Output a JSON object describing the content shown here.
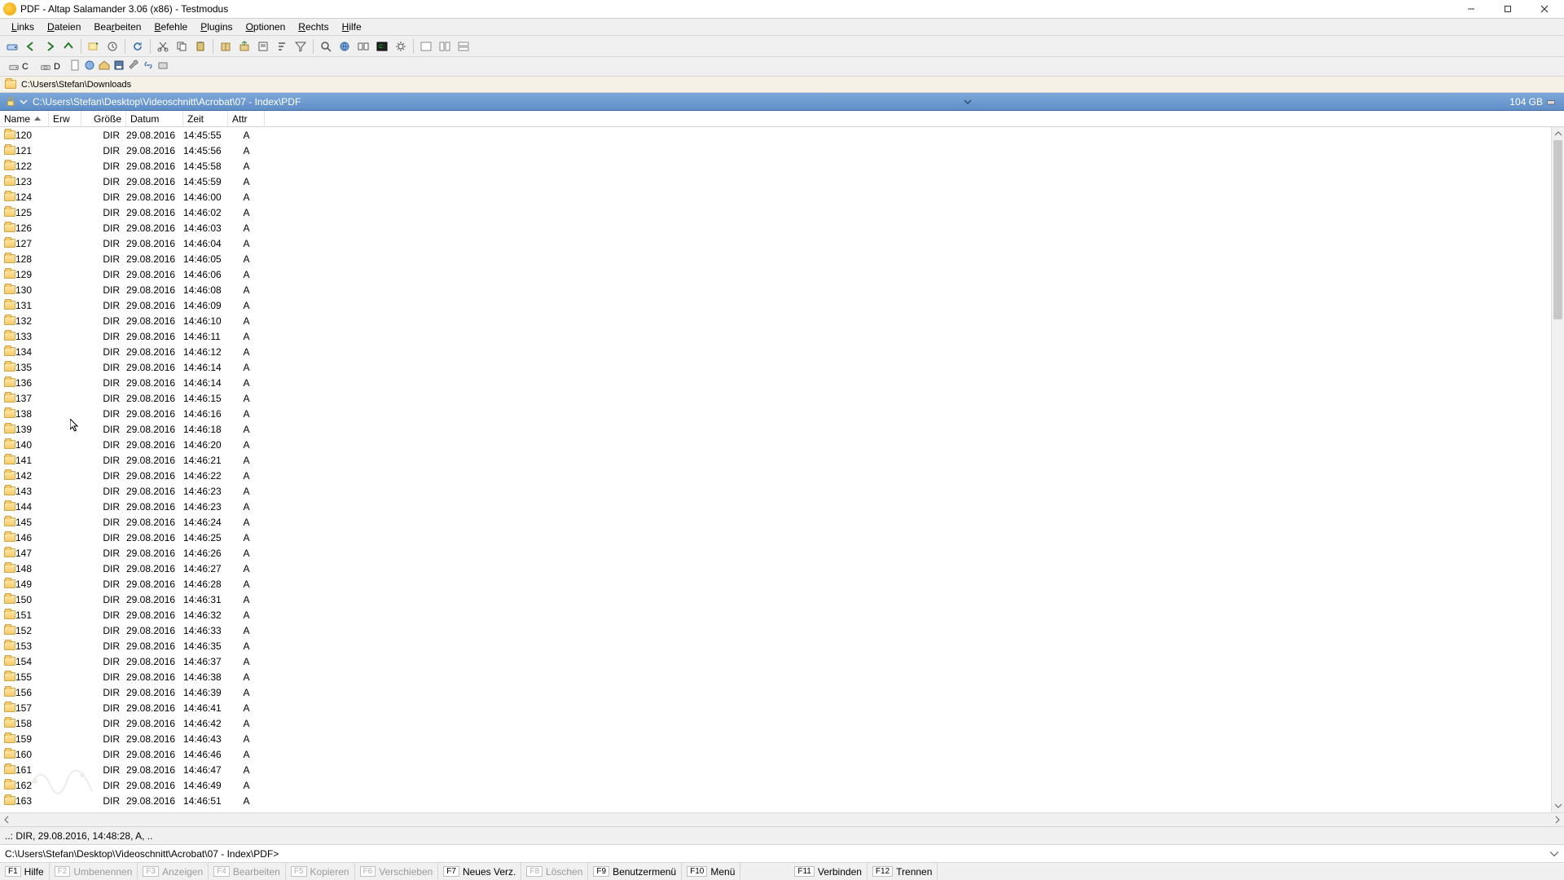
{
  "title": "PDF - Altap Salamander 3.06 (x86) - Testmodus",
  "menu": [
    "Links",
    "Dateien",
    "Bearbeiten",
    "Befehle",
    "Plugins",
    "Optionen",
    "Rechts",
    "Hilfe"
  ],
  "menu_u": [
    "L",
    "D",
    "r",
    "B",
    "P",
    "O",
    "R",
    "H"
  ],
  "inactive_path": "C:\\Users\\Stefan\\Downloads",
  "active_path": "C:\\Users\\Stefan\\Desktop\\Videoschnitt\\Acrobat\\07 - Index\\PDF",
  "disk_free": "104 GB",
  "drives": [
    "C",
    "D"
  ],
  "columns": {
    "name": "Name",
    "ext": "Erw",
    "size": "Größe",
    "date": "Datum",
    "time": "Zeit",
    "attr": "Attr"
  },
  "rows": [
    {
      "name": "120",
      "size": "DIR",
      "date": "29.08.2016",
      "time": "14:45:55",
      "attr": "A"
    },
    {
      "name": "121",
      "size": "DIR",
      "date": "29.08.2016",
      "time": "14:45:56",
      "attr": "A"
    },
    {
      "name": "122",
      "size": "DIR",
      "date": "29.08.2016",
      "time": "14:45:58",
      "attr": "A"
    },
    {
      "name": "123",
      "size": "DIR",
      "date": "29.08.2016",
      "time": "14:45:59",
      "attr": "A"
    },
    {
      "name": "124",
      "size": "DIR",
      "date": "29.08.2016",
      "time": "14:46:00",
      "attr": "A"
    },
    {
      "name": "125",
      "size": "DIR",
      "date": "29.08.2016",
      "time": "14:46:02",
      "attr": "A"
    },
    {
      "name": "126",
      "size": "DIR",
      "date": "29.08.2016",
      "time": "14:46:03",
      "attr": "A"
    },
    {
      "name": "127",
      "size": "DIR",
      "date": "29.08.2016",
      "time": "14:46:04",
      "attr": "A"
    },
    {
      "name": "128",
      "size": "DIR",
      "date": "29.08.2016",
      "time": "14:46:05",
      "attr": "A"
    },
    {
      "name": "129",
      "size": "DIR",
      "date": "29.08.2016",
      "time": "14:46:06",
      "attr": "A"
    },
    {
      "name": "130",
      "size": "DIR",
      "date": "29.08.2016",
      "time": "14:46:08",
      "attr": "A"
    },
    {
      "name": "131",
      "size": "DIR",
      "date": "29.08.2016",
      "time": "14:46:09",
      "attr": "A"
    },
    {
      "name": "132",
      "size": "DIR",
      "date": "29.08.2016",
      "time": "14:46:10",
      "attr": "A"
    },
    {
      "name": "133",
      "size": "DIR",
      "date": "29.08.2016",
      "time": "14:46:11",
      "attr": "A"
    },
    {
      "name": "134",
      "size": "DIR",
      "date": "29.08.2016",
      "time": "14:46:12",
      "attr": "A"
    },
    {
      "name": "135",
      "size": "DIR",
      "date": "29.08.2016",
      "time": "14:46:14",
      "attr": "A"
    },
    {
      "name": "136",
      "size": "DIR",
      "date": "29.08.2016",
      "time": "14:46:14",
      "attr": "A"
    },
    {
      "name": "137",
      "size": "DIR",
      "date": "29.08.2016",
      "time": "14:46:15",
      "attr": "A"
    },
    {
      "name": "138",
      "size": "DIR",
      "date": "29.08.2016",
      "time": "14:46:16",
      "attr": "A"
    },
    {
      "name": "139",
      "size": "DIR",
      "date": "29.08.2016",
      "time": "14:46:18",
      "attr": "A"
    },
    {
      "name": "140",
      "size": "DIR",
      "date": "29.08.2016",
      "time": "14:46:20",
      "attr": "A"
    },
    {
      "name": "141",
      "size": "DIR",
      "date": "29.08.2016",
      "time": "14:46:21",
      "attr": "A"
    },
    {
      "name": "142",
      "size": "DIR",
      "date": "29.08.2016",
      "time": "14:46:22",
      "attr": "A"
    },
    {
      "name": "143",
      "size": "DIR",
      "date": "29.08.2016",
      "time": "14:46:23",
      "attr": "A"
    },
    {
      "name": "144",
      "size": "DIR",
      "date": "29.08.2016",
      "time": "14:46:23",
      "attr": "A"
    },
    {
      "name": "145",
      "size": "DIR",
      "date": "29.08.2016",
      "time": "14:46:24",
      "attr": "A"
    },
    {
      "name": "146",
      "size": "DIR",
      "date": "29.08.2016",
      "time": "14:46:25",
      "attr": "A"
    },
    {
      "name": "147",
      "size": "DIR",
      "date": "29.08.2016",
      "time": "14:46:26",
      "attr": "A"
    },
    {
      "name": "148",
      "size": "DIR",
      "date": "29.08.2016",
      "time": "14:46:27",
      "attr": "A"
    },
    {
      "name": "149",
      "size": "DIR",
      "date": "29.08.2016",
      "time": "14:46:28",
      "attr": "A"
    },
    {
      "name": "150",
      "size": "DIR",
      "date": "29.08.2016",
      "time": "14:46:31",
      "attr": "A"
    },
    {
      "name": "151",
      "size": "DIR",
      "date": "29.08.2016",
      "time": "14:46:32",
      "attr": "A"
    },
    {
      "name": "152",
      "size": "DIR",
      "date": "29.08.2016",
      "time": "14:46:33",
      "attr": "A"
    },
    {
      "name": "153",
      "size": "DIR",
      "date": "29.08.2016",
      "time": "14:46:35",
      "attr": "A"
    },
    {
      "name": "154",
      "size": "DIR",
      "date": "29.08.2016",
      "time": "14:46:37",
      "attr": "A"
    },
    {
      "name": "155",
      "size": "DIR",
      "date": "29.08.2016",
      "time": "14:46:38",
      "attr": "A"
    },
    {
      "name": "156",
      "size": "DIR",
      "date": "29.08.2016",
      "time": "14:46:39",
      "attr": "A"
    },
    {
      "name": "157",
      "size": "DIR",
      "date": "29.08.2016",
      "time": "14:46:41",
      "attr": "A"
    },
    {
      "name": "158",
      "size": "DIR",
      "date": "29.08.2016",
      "time": "14:46:42",
      "attr": "A"
    },
    {
      "name": "159",
      "size": "DIR",
      "date": "29.08.2016",
      "time": "14:46:43",
      "attr": "A"
    },
    {
      "name": "160",
      "size": "DIR",
      "date": "29.08.2016",
      "time": "14:46:46",
      "attr": "A"
    },
    {
      "name": "161",
      "size": "DIR",
      "date": "29.08.2016",
      "time": "14:46:47",
      "attr": "A"
    },
    {
      "name": "162",
      "size": "DIR",
      "date": "29.08.2016",
      "time": "14:46:49",
      "attr": "A"
    },
    {
      "name": "163",
      "size": "DIR",
      "date": "29.08.2016",
      "time": "14:46:51",
      "attr": "A"
    }
  ],
  "status": "..: DIR, 29.08.2016, 14:48:28, A, ..",
  "cmdprompt": "C:\\Users\\Stefan\\Desktop\\Videoschnitt\\Acrobat\\07 - Index\\PDF>",
  "fkeys": [
    {
      "k": "F1",
      "label": "Hilfe",
      "enabled": true
    },
    {
      "k": "F2",
      "label": "Umbenennen",
      "enabled": false
    },
    {
      "k": "F3",
      "label": "Anzeigen",
      "enabled": false
    },
    {
      "k": "F4",
      "label": "Bearbeiten",
      "enabled": false
    },
    {
      "k": "F5",
      "label": "Kopieren",
      "enabled": false
    },
    {
      "k": "F6",
      "label": "Verschieben",
      "enabled": false
    },
    {
      "k": "F7",
      "label": "Neues Verz.",
      "enabled": true
    },
    {
      "k": "F8",
      "label": "Löschen",
      "enabled": false
    },
    {
      "k": "F9",
      "label": "Benutzermenü",
      "enabled": true
    },
    {
      "k": "F10",
      "label": "Menü",
      "enabled": true
    },
    {
      "k": "F11",
      "label": "Verbinden",
      "enabled": true
    },
    {
      "k": "F12",
      "label": "Trennen",
      "enabled": true
    }
  ]
}
